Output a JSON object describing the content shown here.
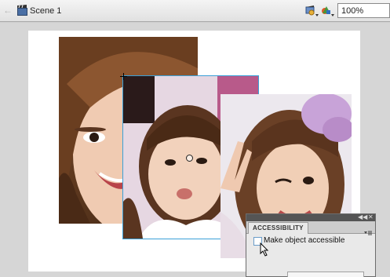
{
  "toolbar": {
    "scene_label": "Scene 1",
    "zoom_value": "100%"
  },
  "icons": {
    "back": "back-arrow-icon",
    "scene": "scene-clapperboard-icon",
    "edit_symbols": "edit-symbols-icon",
    "edit_scene": "edit-scene-icon"
  },
  "panel": {
    "tab_label": "ACCESSIBILITY",
    "checkbox_label": "Make object accessible",
    "checkbox_checked": false
  },
  "colors": {
    "selection": "#3aa0d8",
    "stage": "#ffffff",
    "pasteboard": "#d6d6d6"
  }
}
